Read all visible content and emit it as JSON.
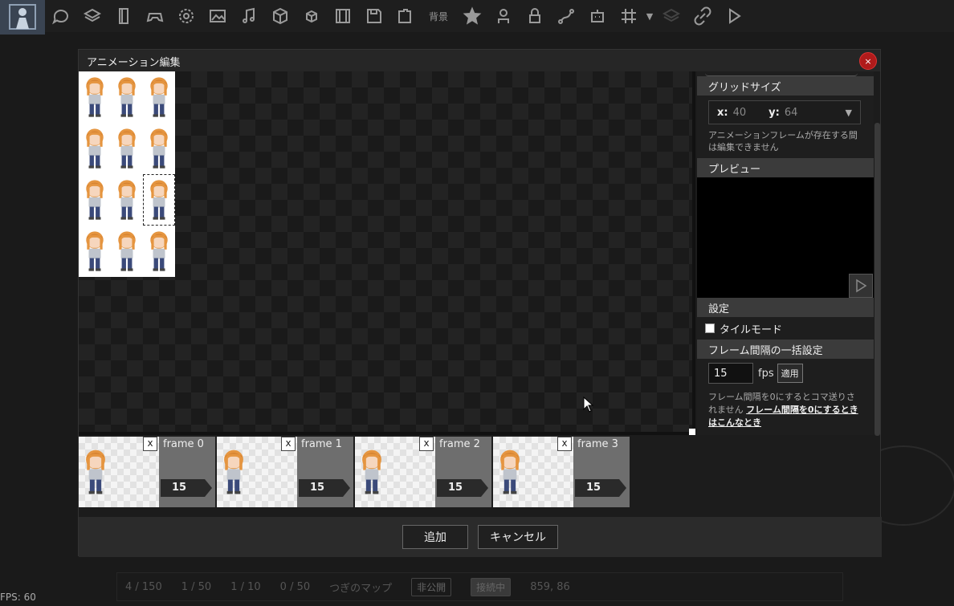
{
  "toolbar": {
    "icons": [
      "logo",
      "chat-icon",
      "layers-icon",
      "card-icon",
      "gamepad-icon",
      "gear-icon",
      "image-icon",
      "music-icon",
      "cube-icon",
      "small-cube-icon",
      "film-icon",
      "save-icon",
      "puzzle-icon",
      "background",
      "star-icon",
      "person-icon",
      "lock-icon",
      "route-icon",
      "robot-icon",
      "grid-icon",
      "dropdown-icon",
      "layers-dim-icon",
      "link-icon",
      "play-icon"
    ],
    "bg_label": "背景"
  },
  "dialog": {
    "title": "アニメーション編集",
    "close_label": "×"
  },
  "panel": {
    "grid_header": "グリッドサイズ",
    "grid_x_label": "x:",
    "grid_x_value": "40",
    "grid_y_label": "y:",
    "grid_y_value": "64",
    "grid_dropdown": "▼",
    "grid_note": "アニメーションフレームが存在する間は編集できません",
    "preview_header": "プレビュー",
    "settings_header": "設定",
    "tile_mode_label": "タイルモード",
    "bulk_header": "フレーム間隔の一括設定",
    "fps_value": "15",
    "fps_unit": "fps",
    "apply_label": "適用",
    "note_prefix": "フレーム間隔を0にするとコマ送りされません",
    "note_link": "フレーム間隔を0にするときはこんなとき"
  },
  "frames": [
    {
      "label": "frame 0",
      "duration": "15"
    },
    {
      "label": "frame 1",
      "duration": "15"
    },
    {
      "label": "frame 2",
      "duration": "15"
    },
    {
      "label": "frame 3",
      "duration": "15"
    }
  ],
  "frame_remove_label": "x",
  "footer": {
    "add_label": "追加",
    "cancel_label": "キャンセル"
  },
  "statusbar": {
    "objects": "4 / 150",
    "scenes": "1 / 50",
    "images": "1 / 10",
    "sounds": "0 / 50",
    "next_map": "つぎのマップ",
    "private": "非公開",
    "connecting": "接続中",
    "coords": "859, 86"
  },
  "fps_counter": "FPS: 60",
  "colors": {
    "close": "#b01b1b",
    "panel_header": "#3b3b3b",
    "frame_side": "#6e6e6e"
  }
}
